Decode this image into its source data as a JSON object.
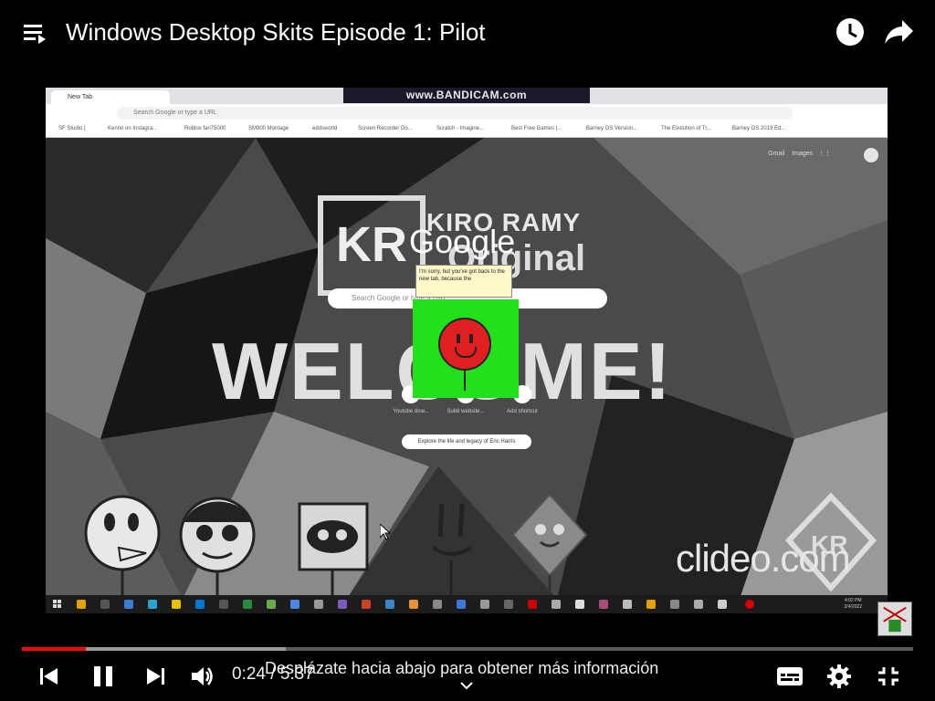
{
  "header": {
    "title": "Windows Desktop Skits Episode 1: Pilot",
    "icons": [
      "playlist-icon",
      "watch-later-icon",
      "share-icon"
    ]
  },
  "video": {
    "browser": {
      "tab_title": "New Tab",
      "watermark": "www.BANDICAM.com",
      "omnibox_placeholder": "Search Google or type a URL",
      "bookmarks": [
        "SF Studio |",
        "Kenno on Instagra...",
        "Roblox fan75000",
        "SM900 Montage",
        "eddsworld",
        "Screen Recorder Do...",
        "Scratch - Imagine...",
        "Best Free Games |...",
        "Barney OS Version...",
        "The Evolution of Tr...",
        "Barney OS 2019 Ed..."
      ],
      "google_links": [
        "Gmail",
        "Images"
      ]
    },
    "wallpaper": {
      "line1": "KIRO RAMY",
      "line2": "Original",
      "logo": "KR",
      "welcome": "WELCOME!"
    },
    "google": {
      "logo": "Google",
      "search_placeholder": "Search Google or type a URL",
      "shortcuts": [
        "Youtube dow...",
        "Sub8 website...",
        "Add shortcut"
      ],
      "explore_chip": "Explore the life and legacy of Eric Harris"
    },
    "speech_bubble": "I'm sorry, but you've got back to the new tab, because the",
    "clideo_watermark": "clideo.com",
    "taskbar_clock": [
      "4:02 PM",
      "2/4/2022"
    ],
    "colors": {
      "green_box": "#22e019",
      "red_face": "#e02020"
    }
  },
  "player": {
    "progress_played_fraction": 0.072,
    "progress_buffered_fraction": 0.296,
    "current_time": "0:24",
    "duration": "5:37",
    "time_text": "0:24 / 5:37",
    "scroll_hint": "Desplázate hacia abajo para obtener más información",
    "controls": [
      "previous-icon",
      "pause-icon",
      "next-icon",
      "volume-icon",
      "subtitles-icon",
      "settings-icon",
      "exit-fullscreen-icon"
    ],
    "accent": "#ff0000"
  }
}
